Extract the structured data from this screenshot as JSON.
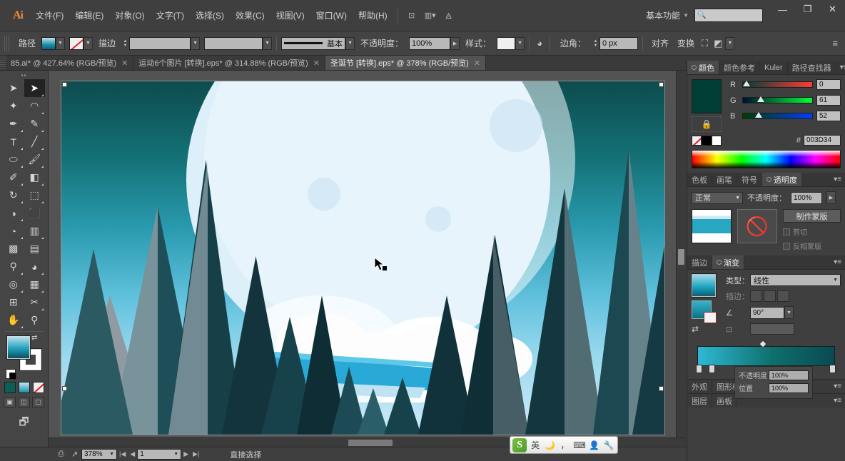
{
  "app": {
    "name": "Ai",
    "logo_text": "Ai"
  },
  "menubar": {
    "items": [
      {
        "label": "文件(F)"
      },
      {
        "label": "编辑(E)"
      },
      {
        "label": "对象(O)"
      },
      {
        "label": "文字(T)"
      },
      {
        "label": "选择(S)"
      },
      {
        "label": "效果(C)"
      },
      {
        "label": "视图(V)"
      },
      {
        "label": "窗口(W)"
      },
      {
        "label": "帮助(H)"
      }
    ],
    "bridge_icon": "bridge-icon",
    "arrange_icon": "arrange-documents-icon",
    "stock_icon": "stock-icon",
    "workspace": "基本功能",
    "search_placeholder": "",
    "minimize": "—",
    "restore": "❐",
    "close": "✕"
  },
  "controlbar": {
    "object_label": "路径",
    "fill_label": "填色",
    "stroke_label": "描边",
    "stroke_weight": "",
    "stroke_profile": "",
    "brush_label": "基本",
    "opacity_label": "不透明度：",
    "opacity_value": "100%",
    "style_label": "样式：",
    "recolor_icon": "recolor-artwork-icon",
    "corner_label": "边角：",
    "corner_value": "0 px",
    "align_label": "对齐",
    "transform_label": "变换",
    "isolate_icon": "isolate-group-icon",
    "mask_icon": "opacity-mask-icon",
    "options_icon": "panel-options-icon"
  },
  "doctabs": [
    {
      "label": "85.ai* @ 427.64% (RGB/预览)",
      "close": "✕",
      "active": false
    },
    {
      "label": "运动6个图片 [转换].eps* @ 314.88% (RGB/预览)",
      "close": "✕",
      "active": false
    },
    {
      "label": "圣诞节 [转换].eps* @ 378% (RGB/预览)",
      "close": "✕",
      "active": true
    }
  ],
  "toolbar": {
    "tools": [
      {
        "name": "selection-tool",
        "glyph": "➤",
        "active": false
      },
      {
        "name": "direct-selection-tool",
        "glyph": "➤",
        "active": true
      },
      {
        "name": "magic-wand-tool",
        "glyph": "✦",
        "active": false
      },
      {
        "name": "lasso-tool",
        "glyph": "◠",
        "active": false
      },
      {
        "name": "pen-tool",
        "glyph": "✒",
        "active": false
      },
      {
        "name": "add-anchor-point-tool",
        "glyph": "✎",
        "active": false
      },
      {
        "name": "type-tool",
        "glyph": "T",
        "active": false
      },
      {
        "name": "line-segment-tool",
        "glyph": "╱",
        "active": false
      },
      {
        "name": "ellipse-tool",
        "glyph": "⬭",
        "active": false
      },
      {
        "name": "paintbrush-tool",
        "glyph": "🖌",
        "active": false
      },
      {
        "name": "blob-brush-tool",
        "glyph": "✐",
        "active": false
      },
      {
        "name": "eraser-tool",
        "glyph": "◧",
        "active": false
      },
      {
        "name": "rotate-tool",
        "glyph": "↻",
        "active": false
      },
      {
        "name": "scale-tool",
        "glyph": "⬚",
        "active": false
      },
      {
        "name": "width-tool",
        "glyph": "◑",
        "active": false
      },
      {
        "name": "free-transform-tool",
        "glyph": "⬛",
        "active": false
      },
      {
        "name": "shape-builder-tool",
        "glyph": "◔",
        "active": false
      },
      {
        "name": "perspective-grid-tool",
        "glyph": "▥",
        "active": false
      },
      {
        "name": "mesh-tool",
        "glyph": "▩",
        "active": false
      },
      {
        "name": "gradient-tool",
        "glyph": "▤",
        "active": false
      },
      {
        "name": "eyedropper-tool",
        "glyph": "⚲",
        "active": false
      },
      {
        "name": "blend-tool",
        "glyph": "◕",
        "active": false
      },
      {
        "name": "symbol-sprayer-tool",
        "glyph": "◎",
        "active": false
      },
      {
        "name": "column-graph-tool",
        "glyph": "▦",
        "active": false
      },
      {
        "name": "artboard-tool",
        "glyph": "⊞",
        "active": false
      },
      {
        "name": "slice-tool",
        "glyph": "✂",
        "active": false
      },
      {
        "name": "hand-tool",
        "glyph": "✋",
        "active": false
      },
      {
        "name": "zoom-tool",
        "glyph": "⚲",
        "active": false
      }
    ],
    "fill_name": "fill-swatch",
    "stroke_name": "stroke-swatch",
    "color_modes": [
      {
        "name": "color-mode-solid"
      },
      {
        "name": "color-mode-gradient"
      },
      {
        "name": "color-mode-none"
      }
    ],
    "screen_modes": [
      {
        "name": "normal-screen-mode",
        "glyph": "▣"
      },
      {
        "name": "fullscreen-menubar-mode",
        "glyph": "◫"
      },
      {
        "name": "fullscreen-mode",
        "glyph": "▢"
      }
    ],
    "change_screen_icon": "change-screen-mode-icon"
  },
  "canvas": {
    "document_name": "圣诞节 [转换].eps",
    "artwork_description": "冬夜雪山松林月亮插画",
    "cursor": "direct-selection-cursor"
  },
  "panels": {
    "color": {
      "tabs": [
        {
          "label": "颜色",
          "active": true
        },
        {
          "label": "颜色参考",
          "active": false
        },
        {
          "label": "Kuler",
          "active": false
        },
        {
          "label": "路径查找器",
          "active": false
        }
      ],
      "swatch_color": "#003D34",
      "sliders": [
        {
          "label": "R",
          "value": "0",
          "pos": 2
        },
        {
          "label": "G",
          "value": "61",
          "pos": 24
        },
        {
          "label": "B",
          "value": "52",
          "pos": 20
        }
      ],
      "hex_label": "#",
      "hex_value": "003D34"
    },
    "transparency": {
      "tabs": [
        {
          "label": "色板",
          "active": false
        },
        {
          "label": "画笔",
          "active": false
        },
        {
          "label": "符号",
          "active": false
        },
        {
          "label": "透明度",
          "active": true
        }
      ],
      "blend_mode": "正常",
      "opacity_label": "不透明度：",
      "opacity_value": "100%",
      "make_mask_label": "制作蒙版",
      "clip_label": "剪切",
      "invert_label": "反相蒙版"
    },
    "gradient": {
      "tabs": [
        {
          "label": "描边",
          "active": false
        },
        {
          "label": "渐变",
          "active": true
        }
      ],
      "type_label": "类型：",
      "type_value": "线性",
      "stroke_label": "描边：",
      "angle_label": "∠",
      "angle_value": "90°",
      "aspect_label": "⊡",
      "aspect_value": "",
      "tooltip": {
        "opacity_label": "不透明度",
        "opacity_value": "100%",
        "location_label": "位置",
        "location_value": "100%"
      }
    },
    "appearance": {
      "tabs": [
        {
          "label": "外观",
          "active": false
        },
        {
          "label": "图形样式",
          "active": false
        }
      ]
    },
    "layers": {
      "tabs": [
        {
          "label": "图层",
          "active": false
        },
        {
          "label": "画板",
          "active": false
        }
      ]
    }
  },
  "statusbar": {
    "zoom_value": "378%",
    "page_value": "1",
    "status_text": "直接选择",
    "first_page": "|◀",
    "prev_page": "◀",
    "next_page": "▶",
    "last_page": "▶|",
    "upload_icon": "upload-icon",
    "share_icon": "share-icon"
  },
  "ime": {
    "logo": "S",
    "mode": "英",
    "moon_icon": "moon-icon",
    "comma_icon": "punctuation-icon",
    "keyboard_icon": "keyboard-icon",
    "user_icon": "user-icon",
    "wrench_icon": "settings-icon"
  }
}
